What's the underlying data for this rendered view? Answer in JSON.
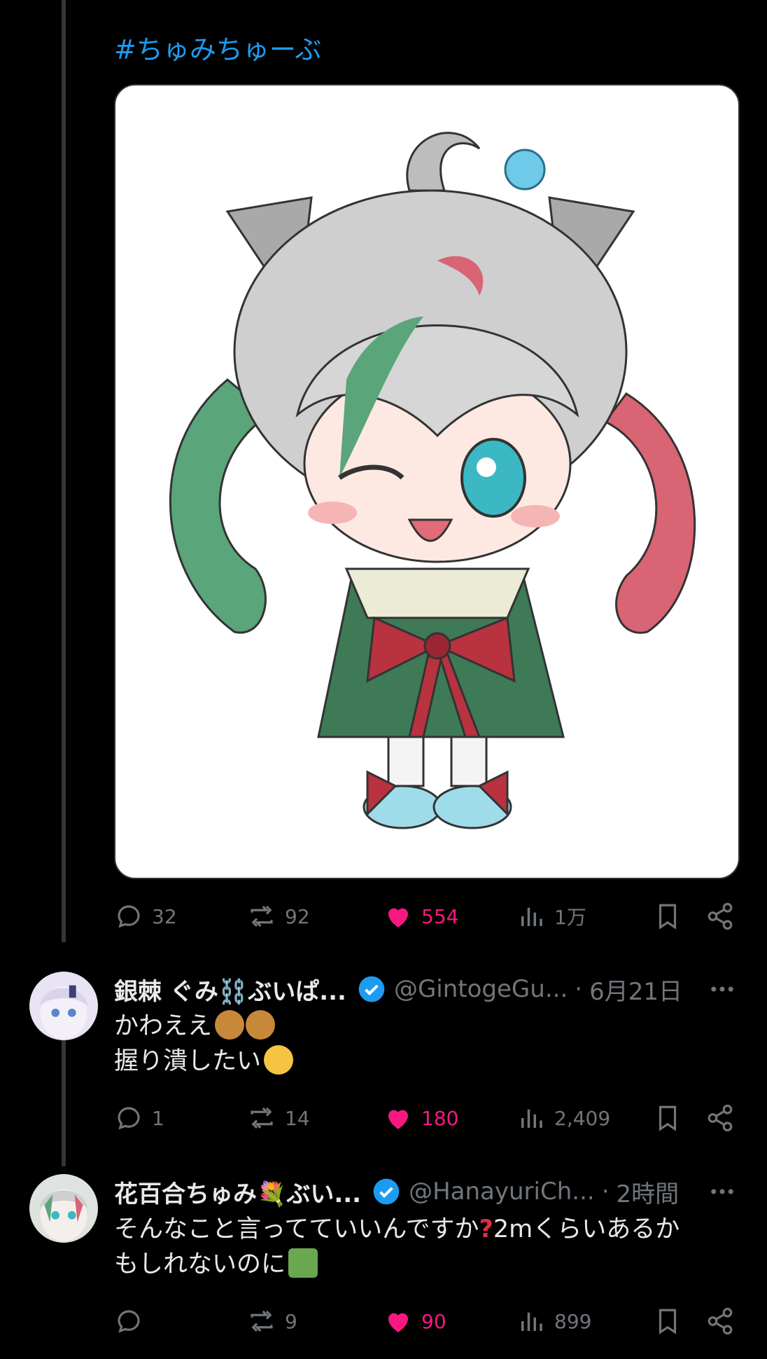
{
  "post": {
    "hashtag": "#ちゅみちゅーぶ",
    "actions": {
      "replies": "32",
      "reposts": "92",
      "likes": "554",
      "views": "1万"
    }
  },
  "replies": [
    {
      "name": "銀棘 ぐみ⛓️ぶいぱ...",
      "handle": "@GintogeGu...",
      "time": "6月21日",
      "lines": [
        "かわええ",
        "握り潰したい"
      ],
      "actions": {
        "replies": "1",
        "reposts": "14",
        "likes": "180",
        "views": "2,409"
      }
    },
    {
      "name": "花百合ちゅみ💐ぶい...",
      "handle": "@HanayuriCh...",
      "time": "2時間",
      "lines": [
        "そんなこと言ってていいんですか",
        "2mくらいあるか",
        "もしれないのに"
      ],
      "actions": {
        "replies": "",
        "reposts": "9",
        "likes": "90",
        "views": "899"
      }
    }
  ],
  "colors": {
    "accent": "#1d9bf0",
    "like": "#f91880",
    "muted": "#71767b"
  },
  "icons": [
    "reply-icon",
    "repost-icon",
    "like-icon",
    "views-icon",
    "bookmark-icon",
    "share-icon",
    "verified-icon",
    "more-icon"
  ]
}
